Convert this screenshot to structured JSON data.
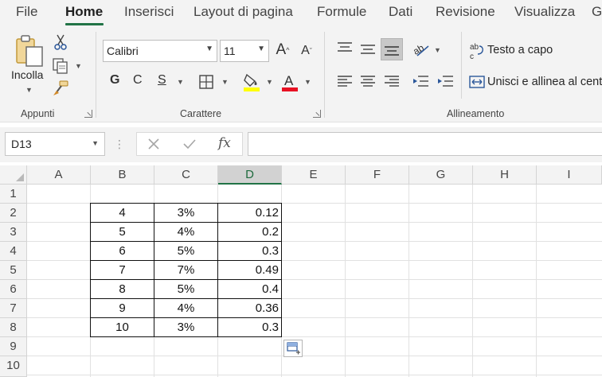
{
  "menu": {
    "tabs": [
      {
        "label": "File"
      },
      {
        "label": "Home"
      },
      {
        "label": "Inserisci"
      },
      {
        "label": "Layout di pagina"
      },
      {
        "label": "Formule"
      },
      {
        "label": "Dati"
      },
      {
        "label": "Revisione"
      },
      {
        "label": "Visualizza"
      },
      {
        "label": "G"
      }
    ],
    "active_tab": "Home"
  },
  "ribbon": {
    "clipboard": {
      "paste_label": "Incolla",
      "group_label": "Appunti"
    },
    "font": {
      "font_name": "Calibri",
      "font_size": "11",
      "bold": "G",
      "italic": "C",
      "underline": "S",
      "group_label": "Carattere"
    },
    "alignment": {
      "wrap_text": "Testo a capo",
      "merge_center": "Unisci e allinea al centro",
      "group_label": "Allineamento"
    }
  },
  "formula_bar": {
    "name_box": "D13",
    "fx_label": "fx",
    "formula": ""
  },
  "columns": [
    "A",
    "B",
    "C",
    "D",
    "E",
    "F",
    "G",
    "H",
    "I"
  ],
  "rows": [
    "1",
    "2",
    "3",
    "4",
    "5",
    "6",
    "7",
    "8",
    "9",
    "10"
  ],
  "selected_column": "D",
  "table": [
    {
      "b": "4",
      "c": "3%",
      "d": "0.12"
    },
    {
      "b": "5",
      "c": "4%",
      "d": "0.2"
    },
    {
      "b": "6",
      "c": "5%",
      "d": "0.3"
    },
    {
      "b": "7",
      "c": "7%",
      "d": "0.49"
    },
    {
      "b": "8",
      "c": "5%",
      "d": "0.4"
    },
    {
      "b": "9",
      "c": "4%",
      "d": "0.36"
    },
    {
      "b": "10",
      "c": "3%",
      "d": "0.3"
    }
  ],
  "colors": {
    "accent": "#217346",
    "font_color": "#e81123",
    "highlight_color": "#ffff00"
  }
}
